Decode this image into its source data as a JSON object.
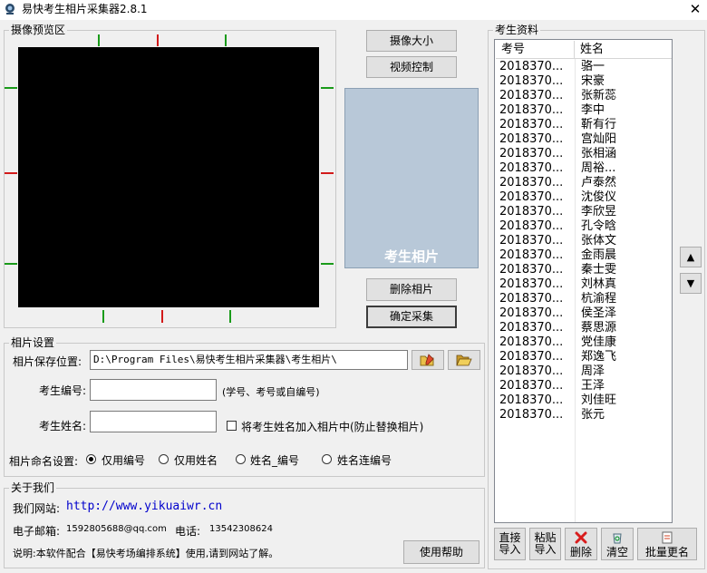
{
  "window": {
    "title": "易快考生相片采集器2.8.1",
    "close": "✕"
  },
  "camera": {
    "group_label": "摄像预览区"
  },
  "buttons": {
    "image_size": "摄像大小",
    "video_control": "视频控制",
    "delete_photo": "删除相片",
    "confirm_capture": "确定采集"
  },
  "photo": {
    "label": "考生相片"
  },
  "settings": {
    "group_label": "相片设置",
    "save_path_label": "相片保存位置:",
    "save_path_value": "D:\\Program Files\\易快考生相片采集器\\考生相片\\",
    "id_label": "考生编号:",
    "id_value": "",
    "id_hint": "(学号、考号或自编号)",
    "name_label": "考生姓名:",
    "name_value": "",
    "add_name_checkbox": "将考生姓名加入相片中(防止替换相片)",
    "naming_label": "相片命名设置:",
    "naming_options": [
      "仅用编号",
      "仅用姓名",
      "姓名_编号",
      "姓名连编号"
    ],
    "naming_selected": 0
  },
  "about": {
    "group_label": "关于我们",
    "website_label": "我们网站:",
    "website_url": "http://www.yikuaiwr.cn",
    "email_label": "电子邮箱:",
    "email_value": "1592805688@qq.com",
    "phone_label": "电话:",
    "phone_value": "13542308624",
    "desc": "说明:本软件配合【易快考场编排系统】使用,请到网站了解。",
    "help_button": "使用帮助"
  },
  "students": {
    "group_label": "考生资料",
    "columns": [
      "考号",
      "姓名"
    ],
    "rows": [
      [
        "2018370...",
        "骆一"
      ],
      [
        "2018370...",
        "宋豪"
      ],
      [
        "2018370...",
        "张新蕊"
      ],
      [
        "2018370...",
        "李中"
      ],
      [
        "2018370...",
        "靳有行"
      ],
      [
        "2018370...",
        "宫灿阳"
      ],
      [
        "2018370...",
        "张相涵"
      ],
      [
        "2018370...",
        "周裕..."
      ],
      [
        "2018370...",
        "卢泰然"
      ],
      [
        "2018370...",
        "沈俊仪"
      ],
      [
        "2018370...",
        "李欣昱"
      ],
      [
        "2018370...",
        "孔令晗"
      ],
      [
        "2018370...",
        "张体文"
      ],
      [
        "2018370...",
        "金雨晨"
      ],
      [
        "2018370...",
        "秦士雯"
      ],
      [
        "2018370...",
        "刘林真"
      ],
      [
        "2018370...",
        "杭渝程"
      ],
      [
        "2018370...",
        "侯圣泽"
      ],
      [
        "2018370...",
        "蔡思源"
      ],
      [
        "2018370...",
        "党佳康"
      ],
      [
        "2018370...",
        "郑逸飞"
      ],
      [
        "2018370...",
        "周泽"
      ],
      [
        "2018370...",
        "王泽"
      ],
      [
        "2018370...",
        "刘佳旺"
      ],
      [
        "2018370...",
        "张元"
      ]
    ]
  },
  "list_buttons": {
    "up": "▲",
    "down": "▼",
    "import_direct": [
      "直接",
      "导入"
    ],
    "import_paste": [
      "粘贴",
      "导入"
    ],
    "delete": "删除",
    "clear": "清空",
    "batch_rename": "批量更名"
  }
}
